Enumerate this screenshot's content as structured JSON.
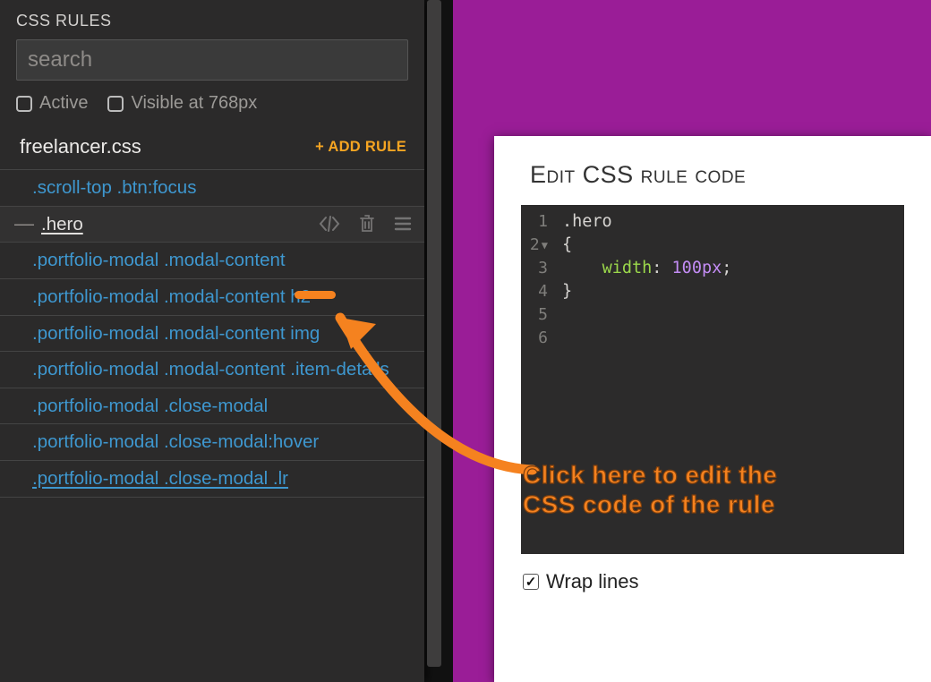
{
  "sidebar": {
    "title": "CSS RULES",
    "search_placeholder": "search",
    "filters": {
      "active": "Active",
      "visible": "Visible at 768px"
    },
    "sheet_name": "freelancer.css",
    "add_rule": "+ ADD RULE",
    "rules": [
      ".scroll-top .btn:focus",
      ".hero",
      ".portfolio-modal .modal-content",
      ".portfolio-modal .modal-content h2",
      ".portfolio-modal .modal-content img",
      ".portfolio-modal .modal-content .item-details",
      ".portfolio-modal .close-modal",
      ".portfolio-modal .close-modal:hover",
      ".portfolio-modal .close-modal .lr"
    ],
    "selected_index": 1
  },
  "editor": {
    "title": "Edit CSS rule code",
    "lines": {
      "l1_selector": ".hero",
      "l2_brace": "{",
      "l3_prop": "width",
      "l3_colon": ": ",
      "l3_val": "100px",
      "l3_semi": ";",
      "l4_brace": "}"
    },
    "wrap_label": "Wrap lines",
    "wrap_checked": true
  },
  "annotation": {
    "line1": "Click here to edit the",
    "line2": "CSS code of the rule"
  }
}
